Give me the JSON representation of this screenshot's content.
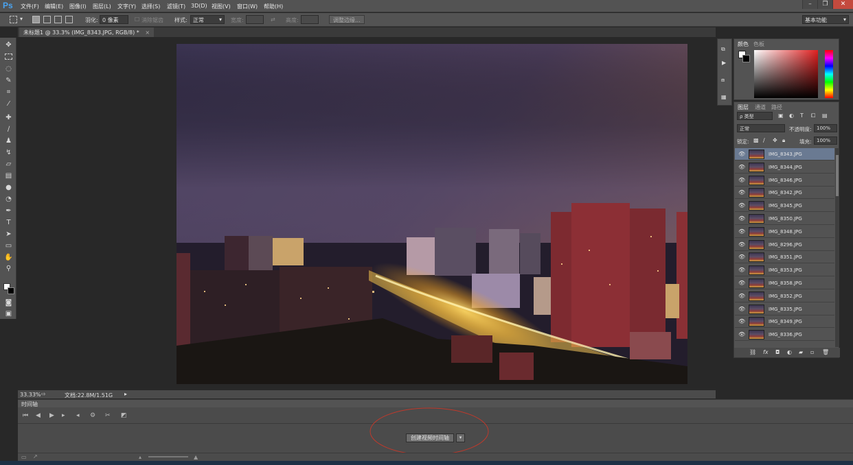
{
  "app": {
    "logo": "Ps"
  },
  "menu": [
    "文件(F)",
    "编辑(E)",
    "图像(I)",
    "图层(L)",
    "文字(Y)",
    "选择(S)",
    "滤镜(T)",
    "3D(D)",
    "视图(V)",
    "窗口(W)",
    "帮助(H)"
  ],
  "window_controls": {
    "minimize": "–",
    "restore": "❐",
    "close": "✕"
  },
  "options": {
    "feather_label": "羽化:",
    "feather_value": "0 像素",
    "antialias_label": "消除锯齿",
    "style_label": "样式:",
    "style_value": "正常",
    "width_label": "宽度:",
    "height_label": "高度:",
    "refine_edge_button": "调整边缘...",
    "workspace": "基本功能"
  },
  "document": {
    "tab_title": "未标题1 @ 33.3% (IMG_8343.JPG, RGB/8) *",
    "tab_close": "×",
    "zoom": "33.33%",
    "doc_info": "文档:22.8M/1.51G"
  },
  "timeline": {
    "title": "时间轴",
    "create_button": "创建视频时间轴",
    "dropdown_arrow": "▾"
  },
  "panels": {
    "color_tab": "颜色",
    "swatches_tab": "色板",
    "layers_tab": "图层",
    "channels_tab": "通道",
    "paths_tab": "路径",
    "filter_kind": "ρ 类型",
    "blend_mode": "正常",
    "opacity_label": "不透明度:",
    "opacity_value": "100%",
    "lock_label": "锁定:",
    "fill_label": "填充:",
    "fill_value": "100%"
  },
  "layers": [
    {
      "name": "IMG_8343.JPG",
      "selected": true
    },
    {
      "name": "IMG_8344.JPG"
    },
    {
      "name": "IMG_8346.JPG"
    },
    {
      "name": "IMG_8342.JPG"
    },
    {
      "name": "IMG_8345.JPG"
    },
    {
      "name": "IMG_8350.JPG"
    },
    {
      "name": "IMG_8348.JPG"
    },
    {
      "name": "IMG_8296.JPG"
    },
    {
      "name": "IMG_8351.JPG"
    },
    {
      "name": "IMG_8353.JPG"
    },
    {
      "name": "IMG_8358.JPG"
    },
    {
      "name": "IMG_8352.JPG"
    },
    {
      "name": "IMG_8335.JPG"
    },
    {
      "name": "IMG_8349.JPG"
    },
    {
      "name": "IMG_8336.JPG"
    }
  ],
  "colors": {
    "selected_layer": "#6a7a92",
    "annotation_circle": "#c0392b",
    "ps_blue": "#4aa3f0"
  }
}
